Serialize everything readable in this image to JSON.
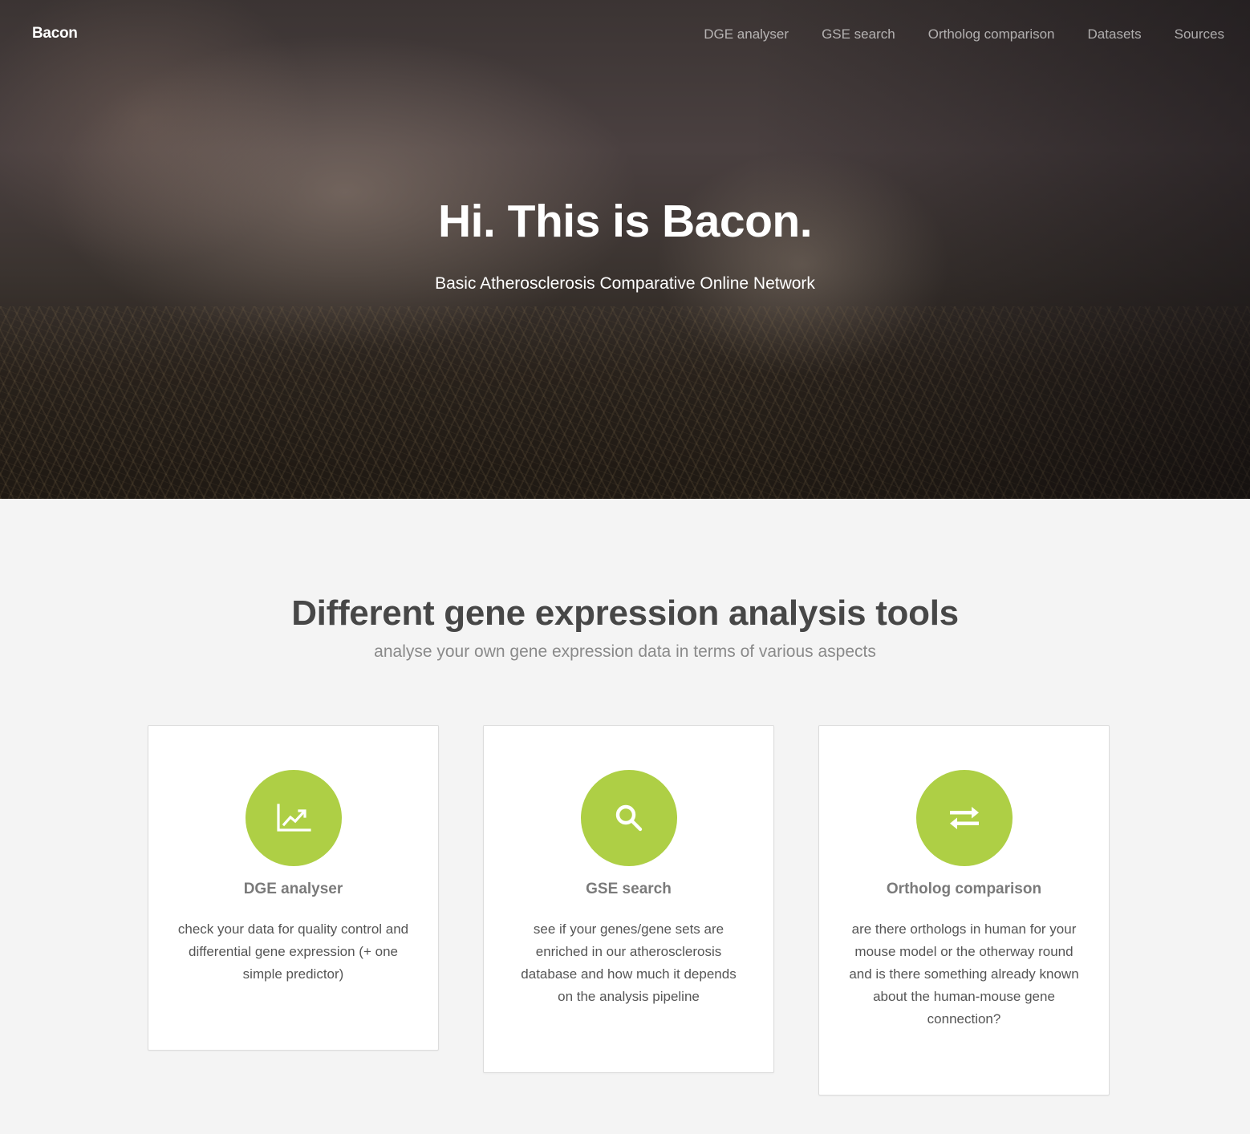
{
  "nav": {
    "brand": "Bacon",
    "links": [
      "DGE analyser",
      "GSE search",
      "Ortholog comparison",
      "Datasets",
      "Sources"
    ]
  },
  "hero": {
    "title": "Hi. This is Bacon.",
    "subtitle": "Basic Atherosclerosis Comparative Online Network"
  },
  "tools": {
    "title": "Different gene expression analysis tools",
    "subtitle": "analyse your own gene expression data in terms of various aspects",
    "cards": [
      {
        "icon": "line-chart-icon",
        "title": "DGE analyser",
        "text": "check your data for quality control and differential gene expression (+ one simple predictor)"
      },
      {
        "icon": "search-icon",
        "title": "GSE search",
        "text": "see if your genes/gene sets are enriched in our atherosclerosis database and how much it depends on the analysis pipeline"
      },
      {
        "icon": "exchange-arrows-icon",
        "title": "Ortholog comparison",
        "text": "are there orthologs in human for your mouse model or the otherway round and is there something already known about the human-mouse gene connection?"
      }
    ]
  },
  "colors": {
    "accent": "#aecf45",
    "page_background": "#f4f4f4",
    "heading": "#474747"
  }
}
